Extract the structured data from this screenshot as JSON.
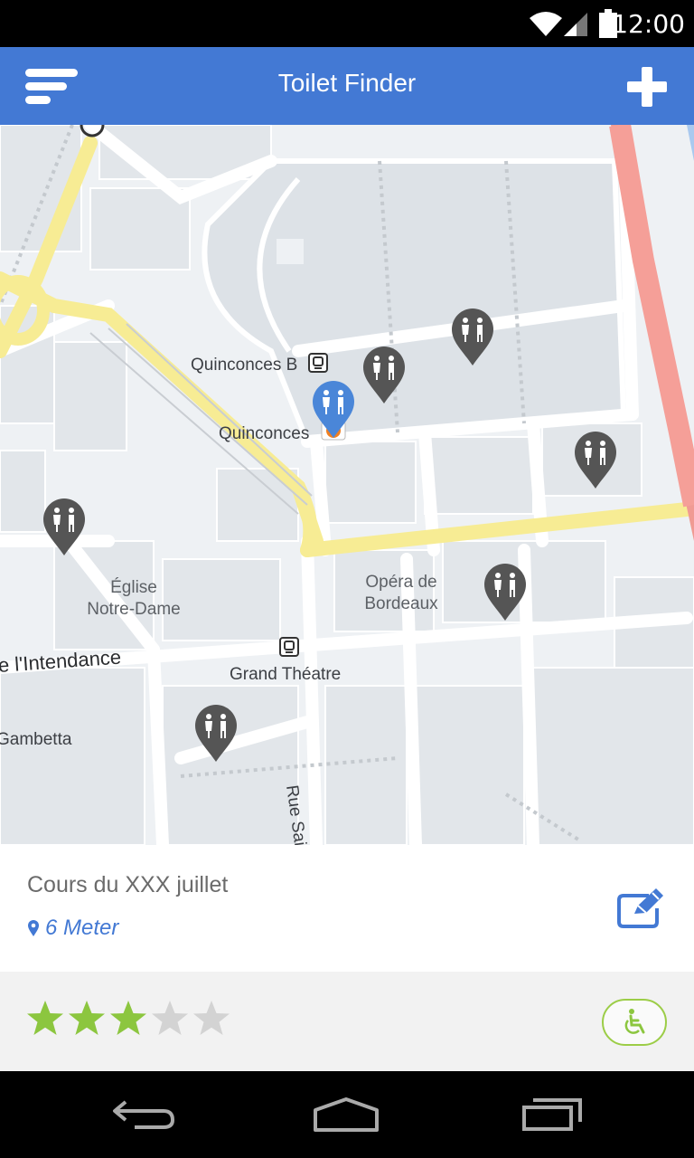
{
  "status_bar": {
    "time": "12:00"
  },
  "app_bar": {
    "title": "Toilet Finder"
  },
  "map": {
    "labels": {
      "quinconces_b": "Quinconces B",
      "quinconces": "Quinconces",
      "eglise_line1": "Église",
      "eglise_line2": "Notre-Dame",
      "opera_line1": "Opéra de",
      "opera_line2": "Bordeaux",
      "intendance": "e  l'Intendance",
      "grand_theatre": "Grand Théatre",
      "gambetta": "Gambetta",
      "rue_sainte": "Rue Sainte-"
    }
  },
  "info": {
    "name": "Cours du XXX juillet",
    "distance": "6 Meter"
  },
  "rating": {
    "value": 3,
    "max": 5
  },
  "colors": {
    "primary": "#4379d4",
    "star_on": "#8cc63f",
    "star_off": "#d3d3d3",
    "pin_gray": "#555555",
    "pin_blue": "#4a86d8",
    "accessible_border": "#9ccd47"
  }
}
